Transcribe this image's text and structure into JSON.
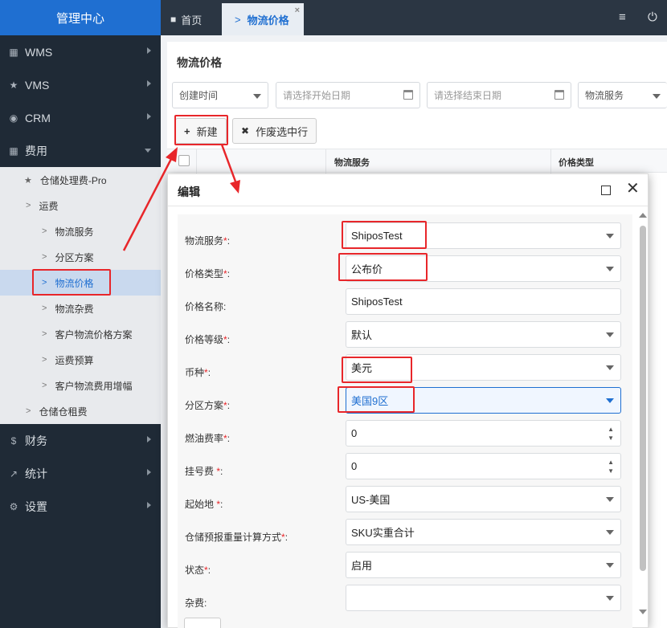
{
  "app": {
    "title": "管理中心"
  },
  "sidebar": {
    "items": [
      {
        "icon": "bank-icon",
        "label": "WMS"
      },
      {
        "icon": "star-icon",
        "label": "VMS"
      },
      {
        "icon": "user-circle-icon",
        "label": "CRM"
      },
      {
        "icon": "table-icon",
        "label": "费用"
      },
      {
        "icon": "dollar-icon",
        "label": "财务"
      },
      {
        "icon": "line-chart-icon",
        "label": "统计"
      },
      {
        "icon": "gear-icon",
        "label": "设置"
      }
    ],
    "fee_submenu": {
      "warehouse_pro": "仓储处理费-Pro",
      "freight": "运费",
      "freight_children": [
        "物流服务",
        "分区方案",
        "物流价格",
        "物流杂费",
        "客户物流价格方案",
        "运费预算",
        "客户物流费用增幅"
      ],
      "storage_rent": "仓储仓租费"
    }
  },
  "tabs": {
    "home": "首页",
    "current": "物流价格",
    "close": "×"
  },
  "page": {
    "title": "物流价格",
    "filters": {
      "time_field": "创建时间",
      "start_date_placeholder": "请选择开始日期",
      "end_date_placeholder": "请选择结束日期",
      "service": "物流服务"
    },
    "buttons": {
      "new": "新建",
      "void": "作废选中行"
    },
    "table_headers": {
      "service": "物流服务",
      "price_type": "价格类型"
    }
  },
  "modal": {
    "title": "编辑",
    "fields": [
      {
        "label": "物流服务",
        "required": true,
        "value": "ShiposTest",
        "kind": "select"
      },
      {
        "label": "价格类型",
        "required": true,
        "value": "公布价",
        "kind": "select"
      },
      {
        "label": "价格名称",
        "required": false,
        "value": "ShiposTest",
        "kind": "text"
      },
      {
        "label": "价格等级",
        "required": true,
        "value": "默认",
        "kind": "select"
      },
      {
        "label": "币种",
        "required": true,
        "value": "美元",
        "kind": "select"
      },
      {
        "label": "分区方案",
        "required": true,
        "value": "美国9区",
        "kind": "select"
      },
      {
        "label": "燃油费率",
        "required": true,
        "value": "0",
        "kind": "number"
      },
      {
        "label": "挂号费 ",
        "required": true,
        "value": "0",
        "kind": "number"
      },
      {
        "label": "起始地 ",
        "required": true,
        "value": "US-美国",
        "kind": "select"
      },
      {
        "label": "仓储预报重量计算方式",
        "required": true,
        "value": "SKU实重合计",
        "kind": "select"
      },
      {
        "label": "状态",
        "required": true,
        "value": "启用",
        "kind": "select"
      },
      {
        "label": "杂费",
        "required": false,
        "value": "",
        "kind": "select"
      }
    ]
  },
  "colors": {
    "accent": "#1f6fd1",
    "annotation_red": "#e8262a",
    "sidebar_bg": "#1f2a36"
  }
}
